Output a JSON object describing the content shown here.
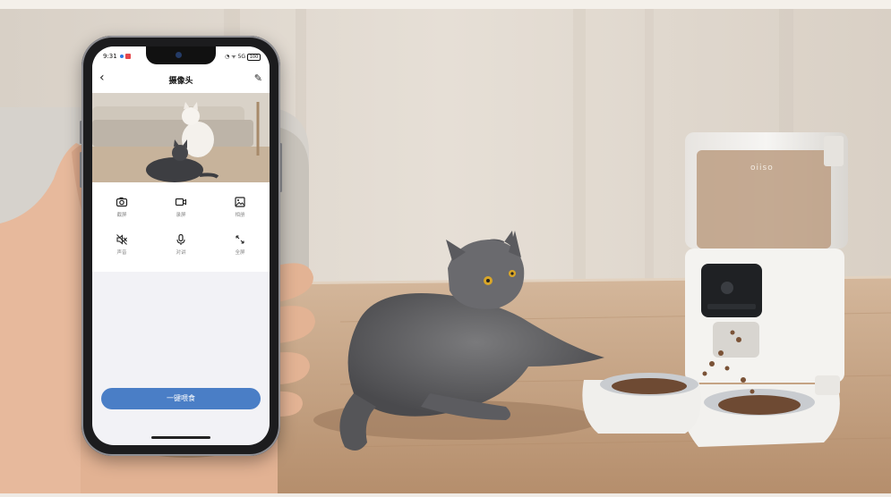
{
  "phone": {
    "status_time": "9:31",
    "status_right": "◔ ᯤ 5G",
    "battery": "100",
    "title": "摄像头",
    "back_glyph": "‹",
    "edit_glyph": "✎",
    "controls": [
      {
        "label": "截屏",
        "icon": "camera-icon"
      },
      {
        "label": "录屏",
        "icon": "video-record-icon"
      },
      {
        "label": "相册",
        "icon": "gallery-icon"
      },
      {
        "label": "声音",
        "icon": "speaker-mute-icon"
      },
      {
        "label": "对讲",
        "icon": "microphone-icon"
      },
      {
        "label": "全屏",
        "icon": "fullscreen-icon"
      }
    ],
    "feed_button": "一键喂食"
  },
  "feeder": {
    "brand": "oiiso"
  },
  "colors": {
    "accent": "#4a7ec6",
    "wall": "#e6ded5",
    "floor": "#c9a98a",
    "feeder": "#f3f3f1"
  }
}
